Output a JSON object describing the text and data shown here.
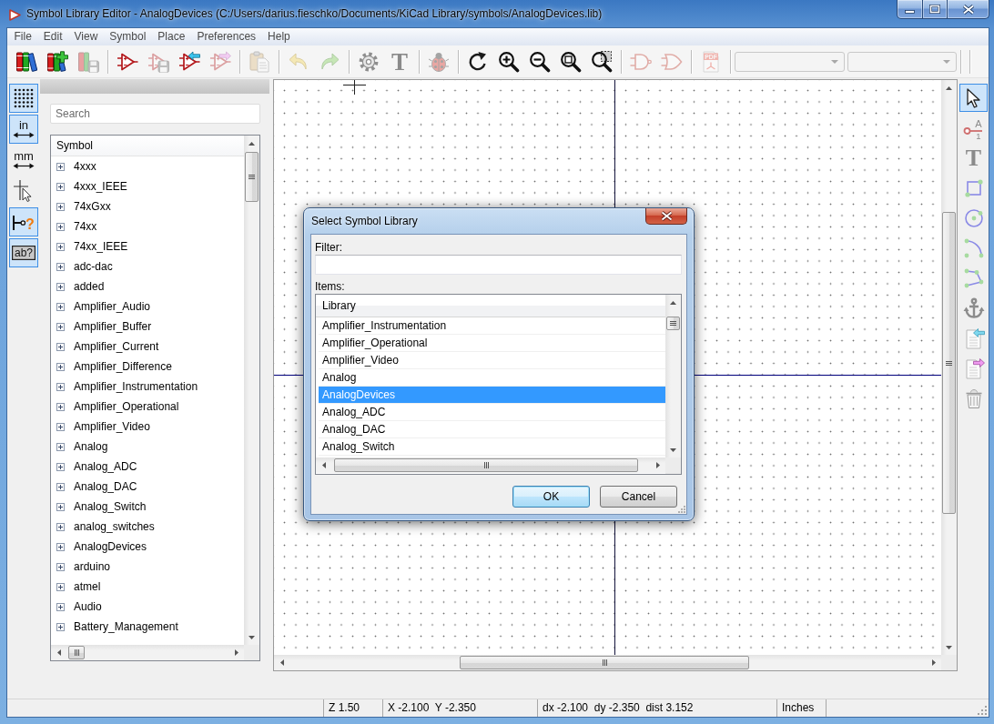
{
  "window": {
    "title": "Symbol Library Editor - AnalogDevices (C:/Users/darius.fieschko/Documents/KiCad Library/symbols/AnalogDevices.lib)"
  },
  "menu": [
    "File",
    "Edit",
    "View",
    "Symbol",
    "Place",
    "Preferences",
    "Help"
  ],
  "toolbar": {
    "groups": [
      [
        {
          "disabled": false
        },
        {
          "disabled": false
        },
        {
          "disabled": true
        }
      ],
      [
        {
          "disabled": false
        },
        {
          "disabled": true
        },
        {
          "disabled": false
        },
        {
          "disabled": true
        }
      ],
      [
        {
          "disabled": true
        }
      ],
      [
        {
          "disabled": true
        },
        {
          "disabled": true
        }
      ],
      [
        {
          "disabled": false
        },
        {
          "disabled": false,
          "label": "T"
        }
      ],
      [
        {
          "disabled": true
        }
      ],
      [
        {
          "disabled": false
        },
        {
          "disabled": false
        },
        {
          "disabled": false
        },
        {
          "disabled": false
        },
        {
          "disabled": false
        }
      ],
      [
        {
          "disabled": true
        },
        {
          "disabled": true
        }
      ],
      [
        {
          "disabled": true,
          "label": "PDF"
        }
      ]
    ],
    "dropdowns": [
      {
        "disabled": true
      },
      {
        "disabled": true
      }
    ]
  },
  "left_toolbar": [
    {
      "on": true
    },
    {
      "on": true,
      "label": "in"
    },
    {
      "on": false,
      "label": "mm"
    },
    {
      "on": false
    },
    {
      "on": true,
      "label": "?"
    },
    {
      "on": true,
      "label": "ab?"
    }
  ],
  "symbol_panel": {
    "search": {
      "placeholder": "Search"
    },
    "tree": {
      "column": "Symbol",
      "items": [
        {
          "label": "4xxx",
          "expanded": false
        },
        {
          "label": "4xxx_IEEE",
          "expanded": false
        },
        {
          "label": "74xGxx",
          "expanded": false
        },
        {
          "label": "74xx",
          "expanded": false
        },
        {
          "label": "74xx_IEEE",
          "expanded": false
        },
        {
          "label": "adc-dac",
          "expanded": false
        },
        {
          "label": "added",
          "expanded": false
        },
        {
          "label": "Amplifier_Audio",
          "expanded": false
        },
        {
          "label": "Amplifier_Buffer",
          "expanded": false
        },
        {
          "label": "Amplifier_Current",
          "expanded": false
        },
        {
          "label": "Amplifier_Difference",
          "expanded": false
        },
        {
          "label": "Amplifier_Instrumentation",
          "expanded": false
        },
        {
          "label": "Amplifier_Operational",
          "expanded": false
        },
        {
          "label": "Amplifier_Video",
          "expanded": false
        },
        {
          "label": "Analog",
          "expanded": false
        },
        {
          "label": "Analog_ADC",
          "expanded": false
        },
        {
          "label": "Analog_DAC",
          "expanded": false
        },
        {
          "label": "Analog_Switch",
          "expanded": false
        },
        {
          "label": "analog_switches",
          "expanded": false
        },
        {
          "label": "AnalogDevices",
          "expanded": false
        },
        {
          "label": "arduino",
          "expanded": false
        },
        {
          "label": "atmel",
          "expanded": false
        },
        {
          "label": "Audio",
          "expanded": false
        },
        {
          "label": "Battery_Management",
          "expanded": false
        }
      ]
    }
  },
  "right_toolbar": [
    {
      "selected": true
    },
    {
      "selected": false,
      "labels": [
        "A",
        "1"
      ]
    },
    {
      "selected": false,
      "label": "T"
    },
    {
      "selected": false
    },
    {
      "selected": false
    },
    {
      "selected": false
    },
    {
      "selected": false
    },
    {
      "selected": false
    },
    {
      "selected": false
    },
    {
      "selected": false
    },
    {
      "selected": false
    }
  ],
  "dialog": {
    "title": "Select Symbol Library",
    "filter": {
      "label": "Filter:"
    },
    "items": {
      "label": "Items:",
      "column": "Library",
      "rows": [
        {
          "label": "Amplifier_Instrumentation",
          "selected": false
        },
        {
          "label": "Amplifier_Operational",
          "selected": false
        },
        {
          "label": "Amplifier_Video",
          "selected": false
        },
        {
          "label": "Analog",
          "selected": false
        },
        {
          "label": "AnalogDevices",
          "selected": true
        },
        {
          "label": "Analog_ADC",
          "selected": false
        },
        {
          "label": "Analog_DAC",
          "selected": false
        },
        {
          "label": "Analog_Switch",
          "selected": false
        }
      ]
    },
    "buttons": [
      {
        "label": "OK",
        "default": true
      },
      {
        "label": "Cancel",
        "default": false
      }
    ]
  },
  "status_bar": [
    "Z 1.50",
    "X -2.100  Y -2.350",
    "dx -2.100  dy -2.350  dist 3.152",
    "Inches"
  ]
}
